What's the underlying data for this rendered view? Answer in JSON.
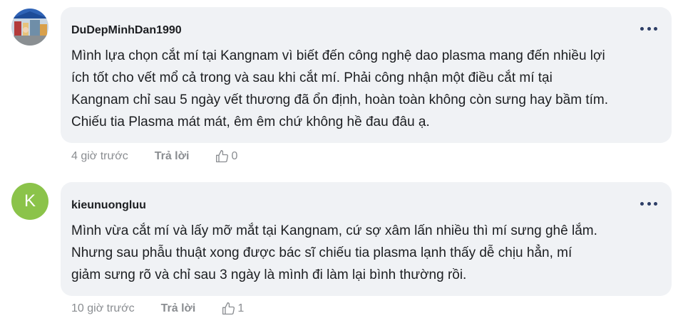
{
  "comments": [
    {
      "author": "DuDepMinhDan1990",
      "avatar_icon": "profile-photo",
      "text_lines": [
        "Mình lựa chọn cắt mí tại Kangnam vì biết đến công nghệ dao plasma mang đến nhiều lợi",
        "ích tốt cho vết mổ cả trong và sau khi cắt mí. Phải công nhận một điều cắt mí tại",
        "Kangnam chỉ sau 5 ngày vết thương đã ổn định, hoàn toàn không còn sưng hay bầm tím.",
        "Chiếu tia Plasma mát mát, êm êm chứ không hề đau đâu ạ."
      ],
      "time": "4 giờ trước",
      "reply_label": "Trả lời",
      "likes": "0"
    },
    {
      "author": "kieunuongluu",
      "avatar_letter": "K",
      "avatar_color": "#8bc34a",
      "text_lines": [
        "Mình vừa cắt mí và lấy mỡ mắt tại Kangnam, cứ sợ xâm lấn nhiều thì mí sưng ghê lắm.",
        "Nhưng sau phẫu thuật xong được bác sĩ chiếu tia plasma lạnh thấy dễ chịu hẳn, mí",
        "giảm sưng rõ và chỉ sau 3 ngày là mình đi làm lại bình thường rồi."
      ],
      "time": "10 giờ trước",
      "reply_label": "Trả lời",
      "likes": "1"
    }
  ],
  "icons": {
    "more": "more-options-icon",
    "like": "thumbs-up-icon"
  },
  "colors": {
    "bubble_bg": "#f0f2f5",
    "text": "#1c1e21",
    "muted": "#8a8d91",
    "more_dots": "#2d3e66"
  }
}
